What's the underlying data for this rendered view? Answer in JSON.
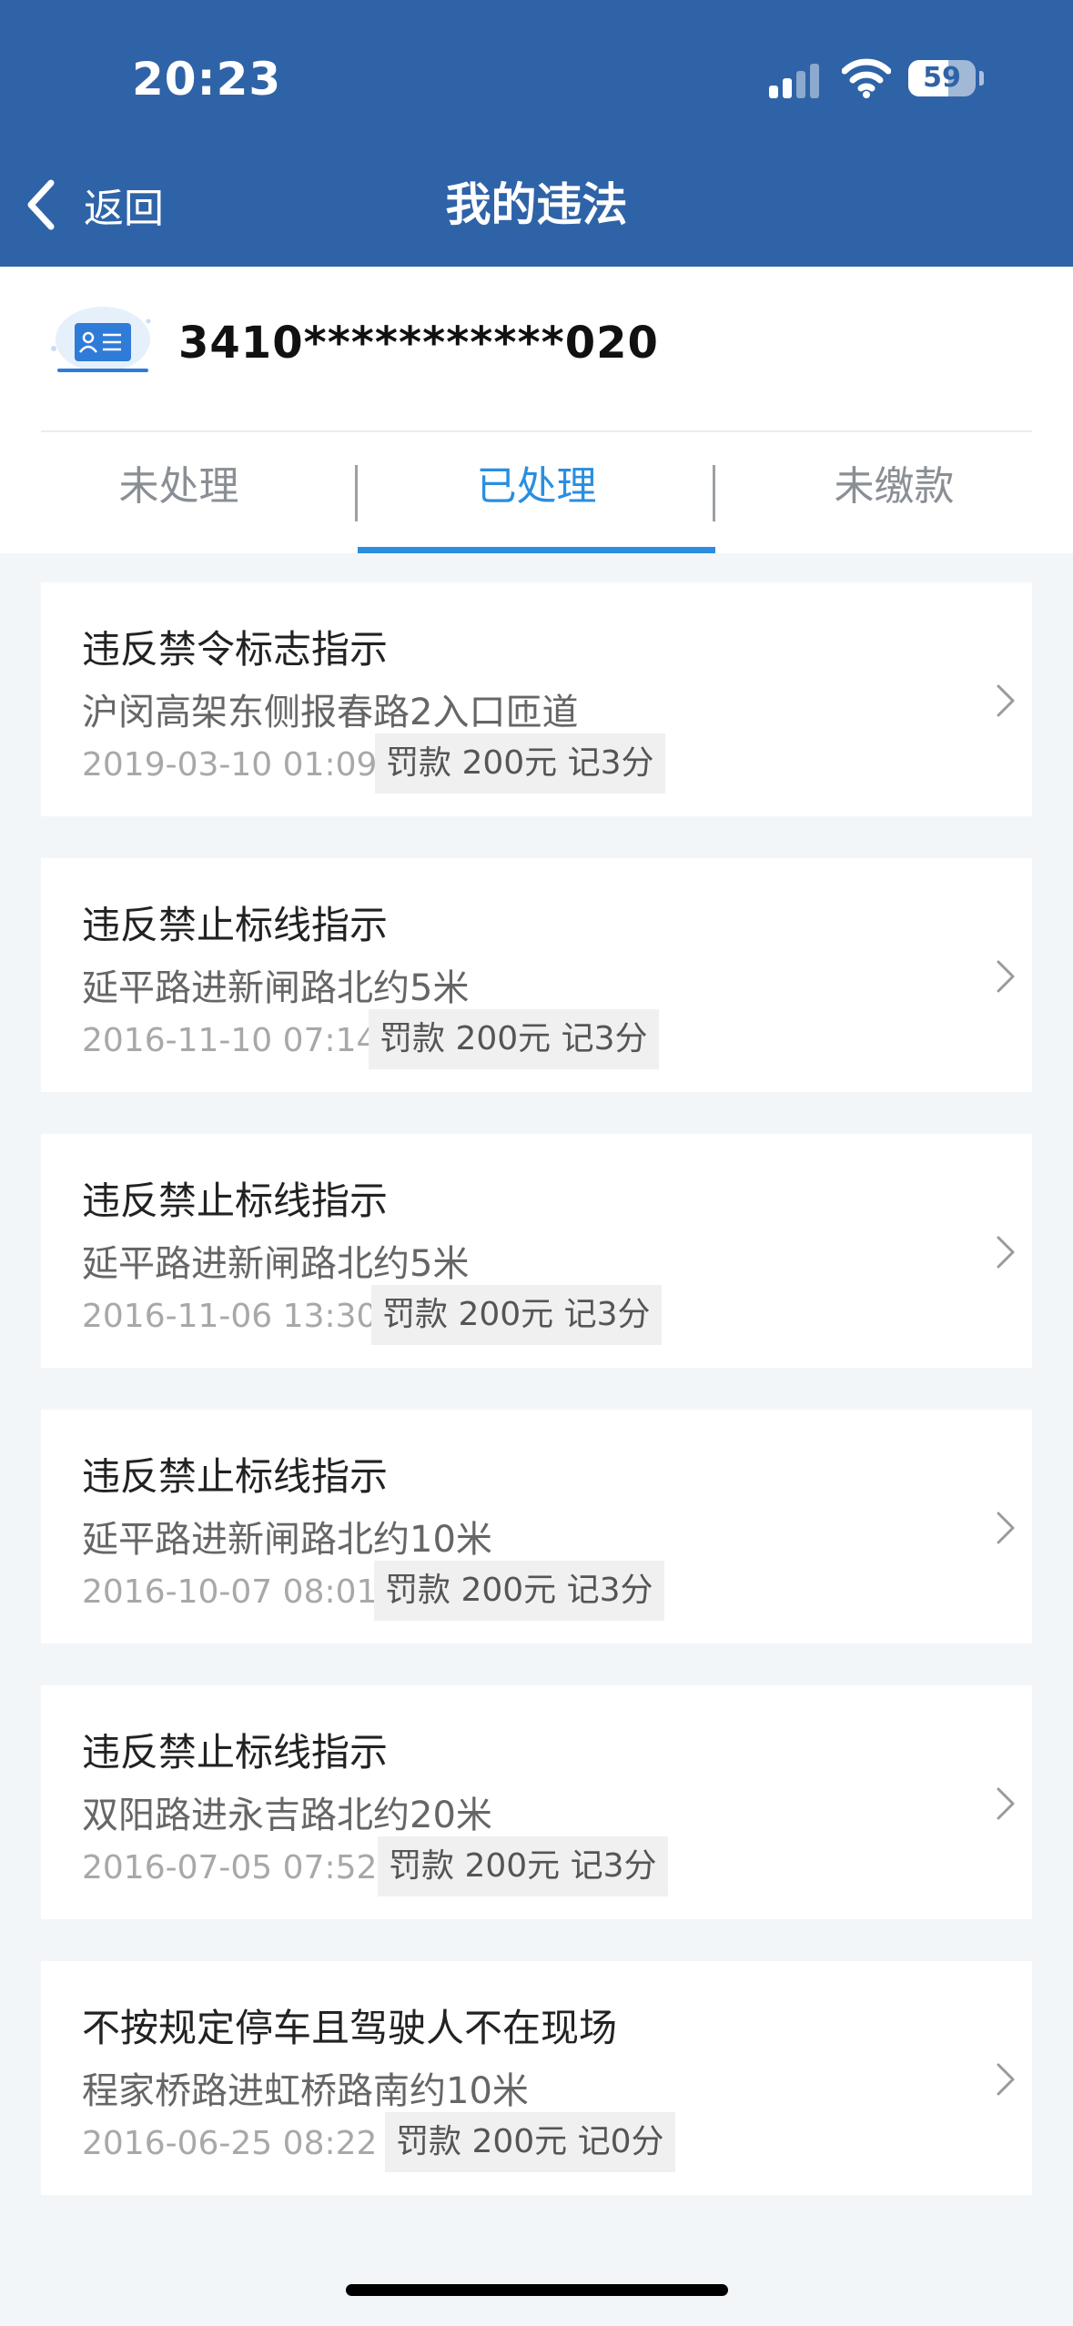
{
  "status_bar": {
    "time": "20:23",
    "battery": "59"
  },
  "nav": {
    "back_label": "返回",
    "title": "我的违法"
  },
  "license": {
    "number": "3410***********020"
  },
  "tabs": [
    {
      "label": "未处理",
      "active": false
    },
    {
      "label": "已处理",
      "active": true
    },
    {
      "label": "未缴款",
      "active": false
    }
  ],
  "violations": [
    {
      "title": "违反禁令标志指示",
      "location": "沪闵高架东侧报春路2入口匝道",
      "datetime": "2019-03-10 01:09",
      "penalty": "罚款 200元 记3分"
    },
    {
      "title": "违反禁止标线指示",
      "location": "延平路进新闸路北约5米",
      "datetime": "2016-11-10 07:14",
      "penalty": "罚款 200元 记3分"
    },
    {
      "title": "违反禁止标线指示",
      "location": "延平路进新闸路北约5米",
      "datetime": "2016-11-06 13:30",
      "penalty": "罚款 200元 记3分"
    },
    {
      "title": "违反禁止标线指示",
      "location": "延平路进新闸路北约10米",
      "datetime": "2016-10-07 08:01",
      "penalty": "罚款 200元 记3分"
    },
    {
      "title": "违反禁止标线指示",
      "location": "双阳路进永吉路北约20米",
      "datetime": "2016-07-05 07:52",
      "penalty": "罚款 200元 记3分"
    },
    {
      "title": "不按规定停车且驾驶人不在现场",
      "location": "程家桥路进虹桥路南约10米",
      "datetime": "2016-06-25 08:22",
      "penalty": "罚款 200元 记0分"
    }
  ],
  "colors": {
    "header_bg": "#2f63a7",
    "accent": "#2a8ee0",
    "page_bg": "#f3f6f9"
  },
  "icons": {
    "back": "chevron-left-icon",
    "row": "chevron-right-icon",
    "license": "id-card-icon"
  }
}
